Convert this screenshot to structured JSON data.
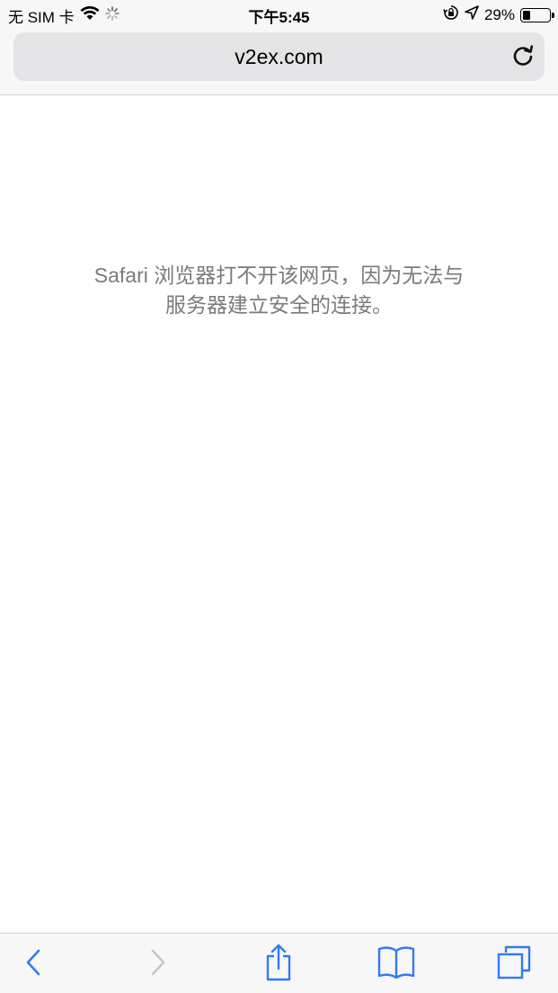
{
  "status_bar": {
    "carrier": "无 SIM 卡",
    "time": "下午5:45",
    "battery_percent": "29%",
    "battery_level": 0.29,
    "icons": [
      "wifi-icon",
      "loading-spinner-icon",
      "orientation-lock-icon",
      "location-arrow-icon",
      "battery-icon"
    ]
  },
  "address_bar": {
    "url": "v2ex.com",
    "reload_icon": "reload-icon"
  },
  "content": {
    "error_line_1": "Safari 浏览器打不开该网页，因为无法与",
    "error_line_2": "服务器建立安全的连接。"
  },
  "toolbar": {
    "items": [
      "back-icon",
      "forward-icon",
      "share-icon",
      "bookmarks-icon",
      "tabs-icon"
    ],
    "forward_enabled": false
  },
  "colors": {
    "accent": "#2f7bf5",
    "disabled": "#c7c7cc",
    "message": "#7a7a7a",
    "chrome_bg": "#f7f7f7",
    "field_bg": "#e4e4e6"
  }
}
